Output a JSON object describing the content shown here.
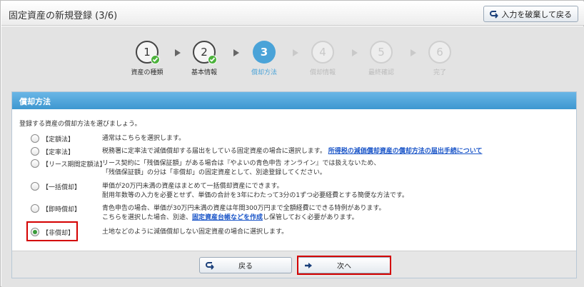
{
  "header": {
    "title": "固定資産の新規登録 (3/6)",
    "discard_label": "入力を破棄して戻る"
  },
  "steps": [
    {
      "num": "1",
      "label": "資産の種類",
      "state": "done"
    },
    {
      "num": "2",
      "label": "基本情報",
      "state": "done"
    },
    {
      "num": "3",
      "label": "償却方法",
      "state": "active"
    },
    {
      "num": "4",
      "label": "償却情報",
      "state": "todo"
    },
    {
      "num": "5",
      "label": "最終確認",
      "state": "todo"
    },
    {
      "num": "6",
      "label": "完了",
      "state": "todo"
    }
  ],
  "panel": {
    "title": "償却方法",
    "intro": "登録する資産の償却方法を選びましょう。",
    "options": [
      {
        "name": "【定額法】",
        "lines": [
          "通常はこちらを選択します。"
        ]
      },
      {
        "name": "【定率法】",
        "lines": [
          "税務署に定率法で減価償却する届出をしている固定資産の場合に選択します。"
        ],
        "link": "所得税の減価償却資産の償却方法の届出手続について"
      },
      {
        "name": "【リース期間定額法】",
        "lines": [
          "リース契約に「残価保証額」がある場合は『やよいの青色申告 オンライン』では扱えないため、",
          "「残価保証額」の分は「非償却」の固定資産として、別途登録してください。"
        ]
      },
      {
        "name": "【一括償却】",
        "lines": [
          "単価が20万円未満の資産はまとめて一括償却資産にできます。",
          "耐用年数等の入力を必要とせず、単価の合計を3年にわたって3分の1ずつ必要経費とする簡便な方法です。"
        ]
      },
      {
        "name": "【即時償却】",
        "lines": [
          "青色申告の場合、単価が30万円未満の資産は年間300万円まで全額経費にできる特例があります。"
        ],
        "line2_pre": "こちらを選択した場合、別途、",
        "line2_link": "固定資産台帳などを作成",
        "line2_post": "し保管しておく必要があります。"
      },
      {
        "name": "【非償却】",
        "lines": [
          "土地などのように減価償却しない固定資産の場合に選択します。"
        ]
      }
    ],
    "selected_option": "【非償却】"
  },
  "footer": {
    "back_label": "戻る",
    "next_label": "次へ"
  },
  "colors": {
    "accent": "#4aa3d8",
    "highlight": "#d40000",
    "check": "#4db33d"
  }
}
